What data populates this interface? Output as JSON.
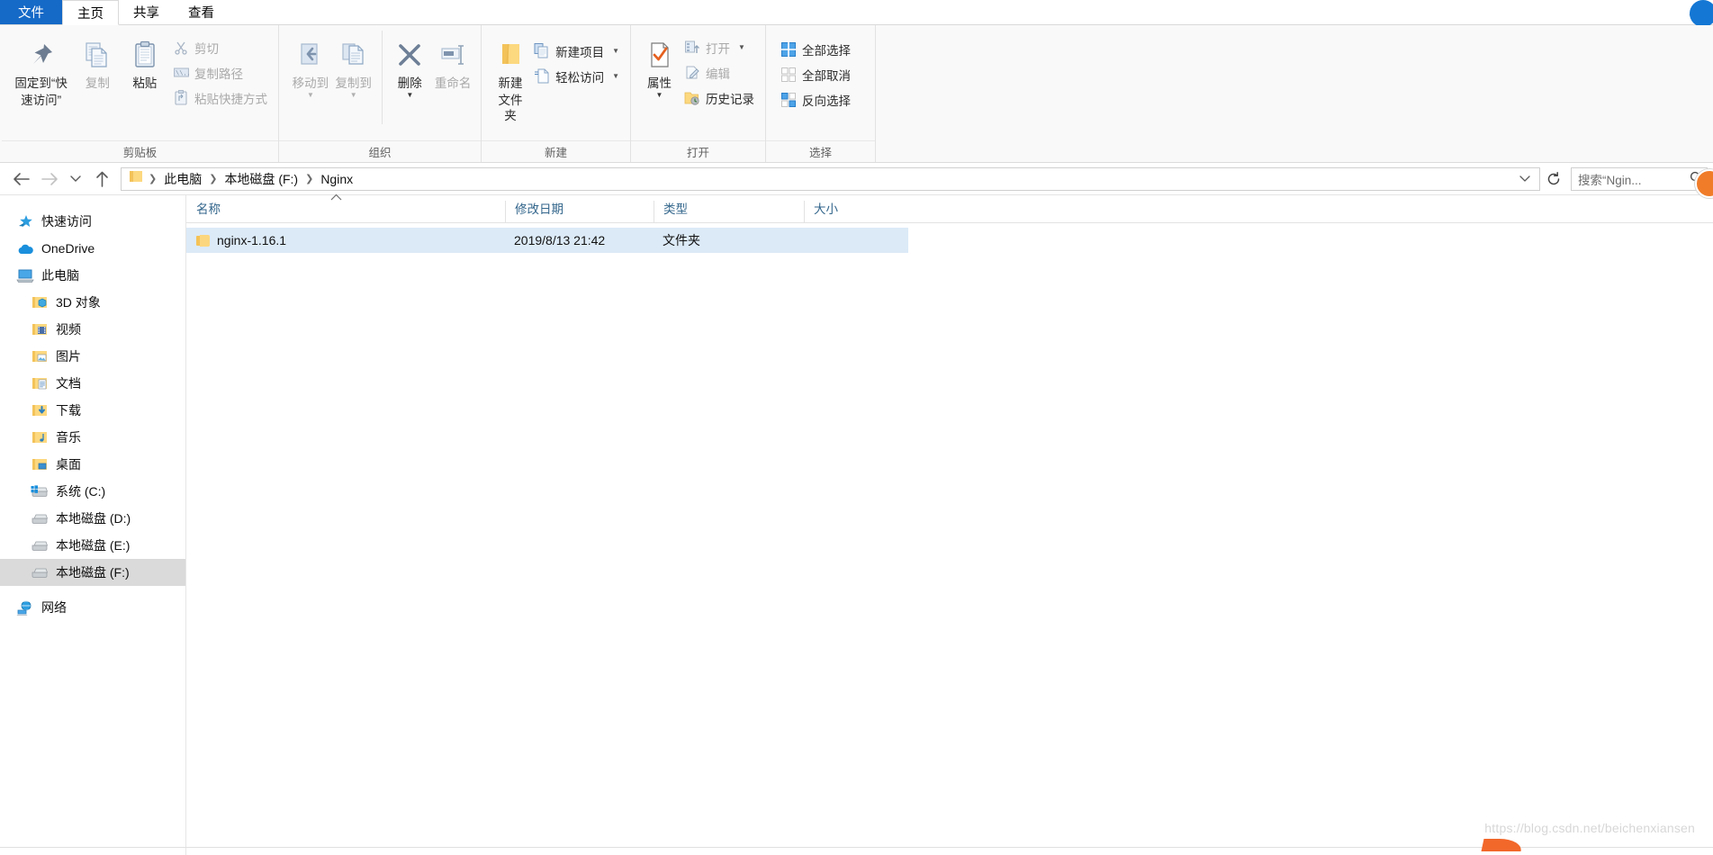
{
  "window": {
    "tabs": [
      {
        "label": "文件",
        "name": "tab-file"
      },
      {
        "label": "主页",
        "name": "tab-home"
      },
      {
        "label": "共享",
        "name": "tab-share"
      },
      {
        "label": "查看",
        "name": "tab-view"
      }
    ],
    "collapse_icon": "chevron-up-icon"
  },
  "ribbon": {
    "groups": [
      {
        "label": "剪贴板"
      },
      {
        "label": "组织"
      },
      {
        "label": "新建"
      },
      {
        "label": "打开"
      },
      {
        "label": "选择"
      }
    ],
    "clipboard": {
      "pin_label": "固定到“快\n速访问”",
      "pin_line1": "固定到“快",
      "pin_line2": "速访问”",
      "copy_label": "复制",
      "paste_label": "粘贴",
      "cut_label": "剪切",
      "copy_path_label": "复制路径",
      "paste_shortcut_label": "粘贴快捷方式"
    },
    "organize": {
      "move_to_label": "移动到",
      "copy_to_label": "复制到",
      "delete_label": "删除",
      "rename_label": "重命名"
    },
    "new": {
      "new_folder_line1": "新建",
      "new_folder_line2": "文件夹",
      "new_item_label": "新建项目",
      "easy_access_label": "轻松访问"
    },
    "open": {
      "properties_label": "属性",
      "open_label": "打开",
      "edit_label": "编辑",
      "history_label": "历史记录"
    },
    "select": {
      "select_all_label": "全部选择",
      "select_none_label": "全部取消",
      "invert_label": "反向选择"
    }
  },
  "address": {
    "back_icon": "arrow-left-icon",
    "forward_icon": "arrow-right-icon",
    "recent_icon": "chevron-down-icon",
    "up_icon": "arrow-up-icon",
    "crumbs": [
      "此电脑",
      "本地磁盘 (F:)",
      "Nginx"
    ],
    "dropdown_icon": "chevron-down-icon",
    "refresh_icon": "refresh-icon",
    "search_placeholder": "搜索“Ngin...",
    "search_value": "",
    "search_icon": "magnifier-icon"
  },
  "sidebar": {
    "items": [
      {
        "label": "快速访问",
        "icon": "star-pin-icon",
        "indent": false,
        "selected": false
      },
      {
        "label": "OneDrive",
        "icon": "cloud-icon",
        "indent": false,
        "selected": false
      },
      {
        "label": "此电脑",
        "icon": "computer-icon",
        "indent": false,
        "selected": false
      },
      {
        "label": "3D 对象",
        "icon": "folder-3d-icon",
        "indent": true,
        "selected": false
      },
      {
        "label": "视频",
        "icon": "folder-video-icon",
        "indent": true,
        "selected": false
      },
      {
        "label": "图片",
        "icon": "folder-pictures-icon",
        "indent": true,
        "selected": false
      },
      {
        "label": "文档",
        "icon": "folder-documents-icon",
        "indent": true,
        "selected": false
      },
      {
        "label": "下载",
        "icon": "folder-downloads-icon",
        "indent": true,
        "selected": false
      },
      {
        "label": "音乐",
        "icon": "folder-music-icon",
        "indent": true,
        "selected": false
      },
      {
        "label": "桌面",
        "icon": "folder-desktop-icon",
        "indent": true,
        "selected": false
      },
      {
        "label": "系统 (C:)",
        "icon": "drive-windows-icon",
        "indent": true,
        "selected": false
      },
      {
        "label": "本地磁盘 (D:)",
        "icon": "drive-icon",
        "indent": true,
        "selected": false
      },
      {
        "label": "本地磁盘 (E:)",
        "icon": "drive-icon",
        "indent": true,
        "selected": false
      },
      {
        "label": "本地磁盘 (F:)",
        "icon": "drive-icon",
        "indent": true,
        "selected": true
      },
      {
        "label": "网络",
        "icon": "network-icon",
        "indent": false,
        "selected": false
      }
    ]
  },
  "filelist": {
    "columns": [
      {
        "label": "名称",
        "key": "name"
      },
      {
        "label": "修改日期",
        "key": "date"
      },
      {
        "label": "类型",
        "key": "type"
      },
      {
        "label": "大小",
        "key": "size"
      }
    ],
    "sort_indicator": "ascending-caret-icon",
    "rows": [
      {
        "name": "nginx-1.16.1",
        "date": "2019/8/13 21:42",
        "type": "文件夹",
        "size": "",
        "icon": "folder-icon",
        "selected": true
      }
    ]
  },
  "watermark": {
    "text": "https://blog.csdn.net/beichenxiansen"
  },
  "colors": {
    "accent_blue": "#1569c7",
    "selection_blue": "#dceaf7",
    "header_text": "#33668c",
    "folder_yellow": "#fcd67e",
    "orange": "#f07c29"
  }
}
